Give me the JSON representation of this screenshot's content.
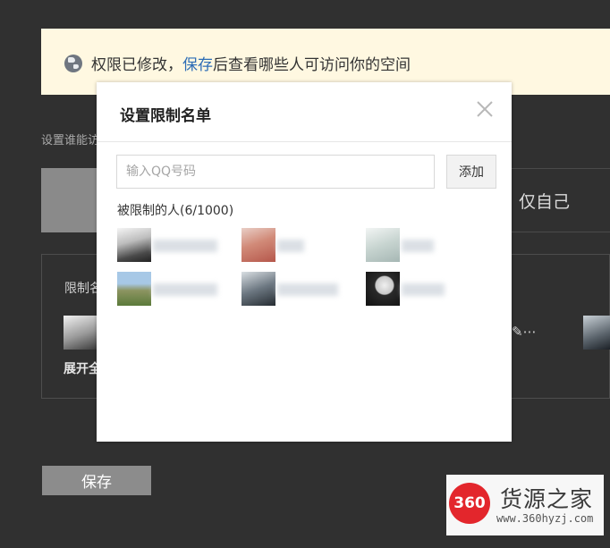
{
  "notice": {
    "prefix": "权限已修改，",
    "link": "保存",
    "suffix": "后查看哪些人可访问你的空间"
  },
  "background": {
    "who_can_view_label": "设置谁能访",
    "only_self_option": "仅自己",
    "restricted_list_label": "限制名",
    "expand_all": "展开全",
    "edit_more": "✎⋯",
    "save_button": "保存"
  },
  "dialog": {
    "title": "设置限制名单",
    "input_placeholder": "输入QQ号码",
    "input_value": "",
    "add_button": "添加",
    "restricted_count_label": "被限制的人(6/1000)",
    "people": [
      {
        "avatar": "avatar-image",
        "name": ""
      },
      {
        "avatar": "avatar-image",
        "name": ""
      },
      {
        "avatar": "avatar-image",
        "name": ""
      },
      {
        "avatar": "avatar-image",
        "name": ""
      },
      {
        "avatar": "avatar-image",
        "name": ""
      },
      {
        "avatar": "avatar-image",
        "name": ""
      }
    ]
  },
  "watermark": {
    "badge": "360",
    "name": "货源之家",
    "url": "www.360hyzj.com"
  },
  "colors": {
    "backdrop": "#303030",
    "notice_bg": "#fff8e1",
    "link": "#2d6db6",
    "save_button_bg": "#8c8c8c",
    "badge_red": "#e3262c"
  },
  "icons": {
    "notice": "globe-icon",
    "close": "close-icon"
  }
}
